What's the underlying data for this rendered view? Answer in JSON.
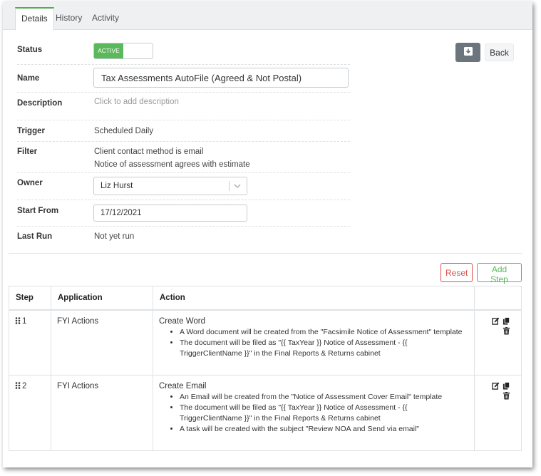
{
  "tabs": [
    {
      "label": "Details",
      "active": true
    },
    {
      "label": "History",
      "active": false
    },
    {
      "label": "Activity",
      "active": false
    }
  ],
  "details": {
    "status_label": "Status",
    "status_value": "ACTIVE",
    "name_label": "Name",
    "name_value": "Tax Assessments AutoFile (Agreed & Not Postal)",
    "description_label": "Description",
    "description_placeholder": "Click to add description",
    "trigger_label": "Trigger",
    "trigger_value": "Scheduled Daily",
    "filter_label": "Filter",
    "filter_values": [
      "Client contact method is email",
      "Notice of assessment agrees with estimate"
    ],
    "owner_label": "Owner",
    "owner_value": "Liz Hurst",
    "start_from_label": "Start From",
    "start_from_value": "17/12/2021",
    "last_run_label": "Last Run",
    "last_run_value": "Not yet run"
  },
  "header_actions": {
    "archive_icon": "archive-icon",
    "back_label": "Back"
  },
  "steps_toolbar": {
    "reset_label": "Reset",
    "add_step_label": "Add Step"
  },
  "steps_table": {
    "columns": [
      "Step",
      "Application",
      "Action"
    ],
    "rows": [
      {
        "step": "1",
        "application": "FYI Actions",
        "action_title": "Create Word",
        "bullets": [
          "A Word document will be created from the \"Facsimile Notice of Assessment\" template",
          "The document will be filed as \"{{ TaxYear }} Notice of Assessment - {{ TriggerClientName }}\" in the Final Reports & Returns cabinet"
        ]
      },
      {
        "step": "2",
        "application": "FYI Actions",
        "action_title": "Create Email",
        "bullets": [
          "An Email will be created from the \"Notice of Assessment Cover Email\" template",
          "The document will be filed as \"{{ TaxYear }} Notice of Assessment - {{ TriggerClientName }}\" in the Final Reports & Returns cabinet",
          "A task will be created with the subject \"Review NOA and Send via email\""
        ]
      }
    ]
  },
  "colors": {
    "active_green": "#5cb85c",
    "danger_red": "#d9534f",
    "archive_gray": "#6c757d"
  }
}
